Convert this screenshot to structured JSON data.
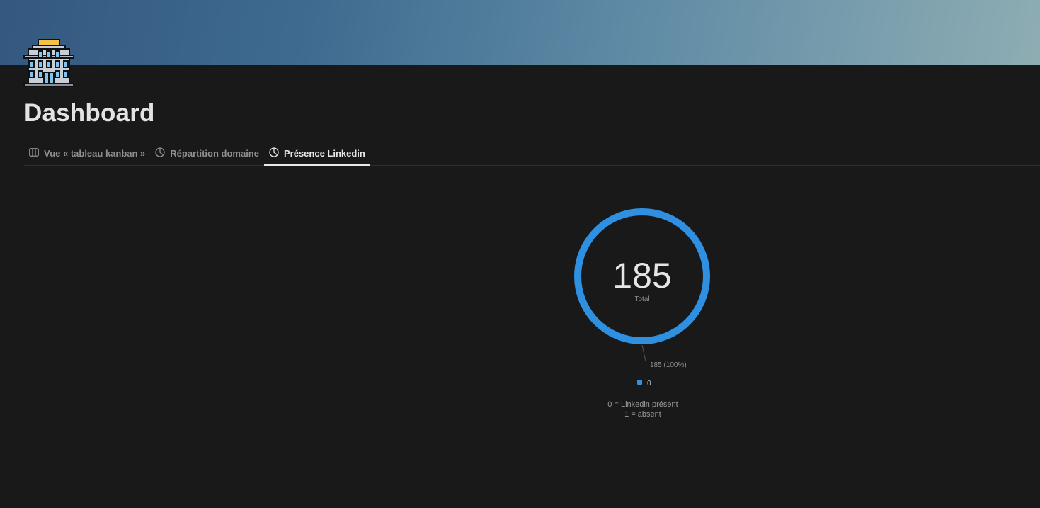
{
  "page": {
    "title": "Dashboard",
    "icon": "office-building-icon"
  },
  "tabs": [
    {
      "label": "Vue « tableau kanban »",
      "icon": "board-icon",
      "active": false
    },
    {
      "label": "Répartition domaine",
      "icon": "pie-chart-icon",
      "active": false
    },
    {
      "label": "Présence Linkedin",
      "icon": "pie-chart-icon",
      "active": true
    }
  ],
  "colors": {
    "accent": "#2f8fe0",
    "background": "#191919"
  },
  "chart_data": {
    "type": "pie",
    "variant": "donut",
    "center_value": "185",
    "center_label": "Total",
    "slices": [
      {
        "name": "0",
        "value": 185,
        "label": "185 (100%)",
        "color": "#2f8fe0"
      }
    ],
    "legend": [
      "0"
    ],
    "legend_position": "bottom",
    "caption_lines": [
      "0 = Linkedin présent",
      "1 = absent"
    ]
  }
}
